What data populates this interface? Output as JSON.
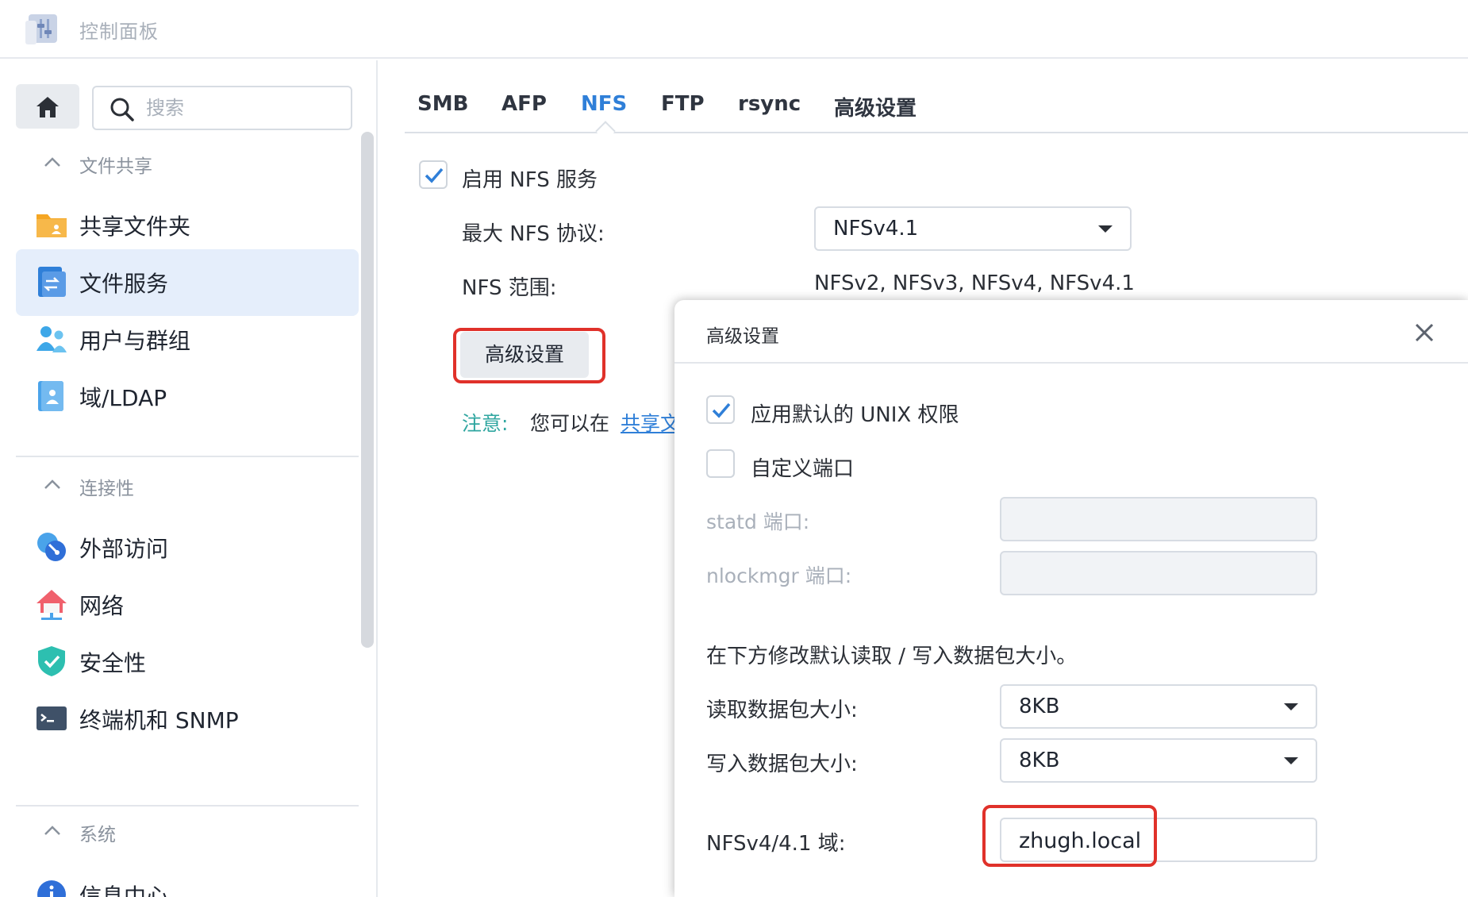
{
  "window": {
    "title": "控制面板"
  },
  "sidebar": {
    "search_placeholder": "搜索",
    "groups": [
      {
        "label": "文件共享"
      },
      {
        "label": "连接性"
      },
      {
        "label": "系统"
      }
    ],
    "items": [
      {
        "label": "共享文件夹"
      },
      {
        "label": "文件服务"
      },
      {
        "label": "用户与群组"
      },
      {
        "label": "域/LDAP"
      },
      {
        "label": "外部访问"
      },
      {
        "label": "网络"
      },
      {
        "label": "安全性"
      },
      {
        "label": "终端机和 SNMP"
      },
      {
        "label": "信息中心"
      }
    ]
  },
  "tabs": [
    {
      "label": "SMB"
    },
    {
      "label": "AFP"
    },
    {
      "label": "NFS"
    },
    {
      "label": "FTP"
    },
    {
      "label": "rsync"
    },
    {
      "label": "高级设置"
    }
  ],
  "nfs": {
    "enable_label": "启用 NFS 服务",
    "max_protocol_label": "最大 NFS 协议:",
    "max_protocol_value": "NFSv4.1",
    "range_label": "NFS 范围:",
    "range_value": "NFSv2, NFSv3, NFSv4, NFSv4.1",
    "advanced_button": "高级设置",
    "note_label": "注意:",
    "note_text": "您可以在",
    "note_link": "共享文"
  },
  "dialog": {
    "title": "高级设置",
    "unix_perm_label": "应用默认的 UNIX 权限",
    "custom_port_label": "自定义端口",
    "statd_label": "statd 端口:",
    "statd_value": "",
    "nlockmgr_label": "nlockmgr 端口:",
    "nlockmgr_value": "",
    "packet_desc": "在下方修改默认读取 / 写入数据包大小。",
    "read_label": "读取数据包大小:",
    "read_value": "8KB",
    "write_label": "写入数据包大小:",
    "write_value": "8KB",
    "domain_label": "NFSv4/4.1 域:",
    "domain_value": "zhugh.local"
  },
  "colors": {
    "accent": "#2f7fd8",
    "highlight_box": "#e0312a",
    "note": "#2fa6a0",
    "active_item_bg": "#e5eefb"
  },
  "icons": {
    "app": "control-panel-icon",
    "home": "home-icon",
    "search": "search-icon",
    "close": "close-icon"
  }
}
